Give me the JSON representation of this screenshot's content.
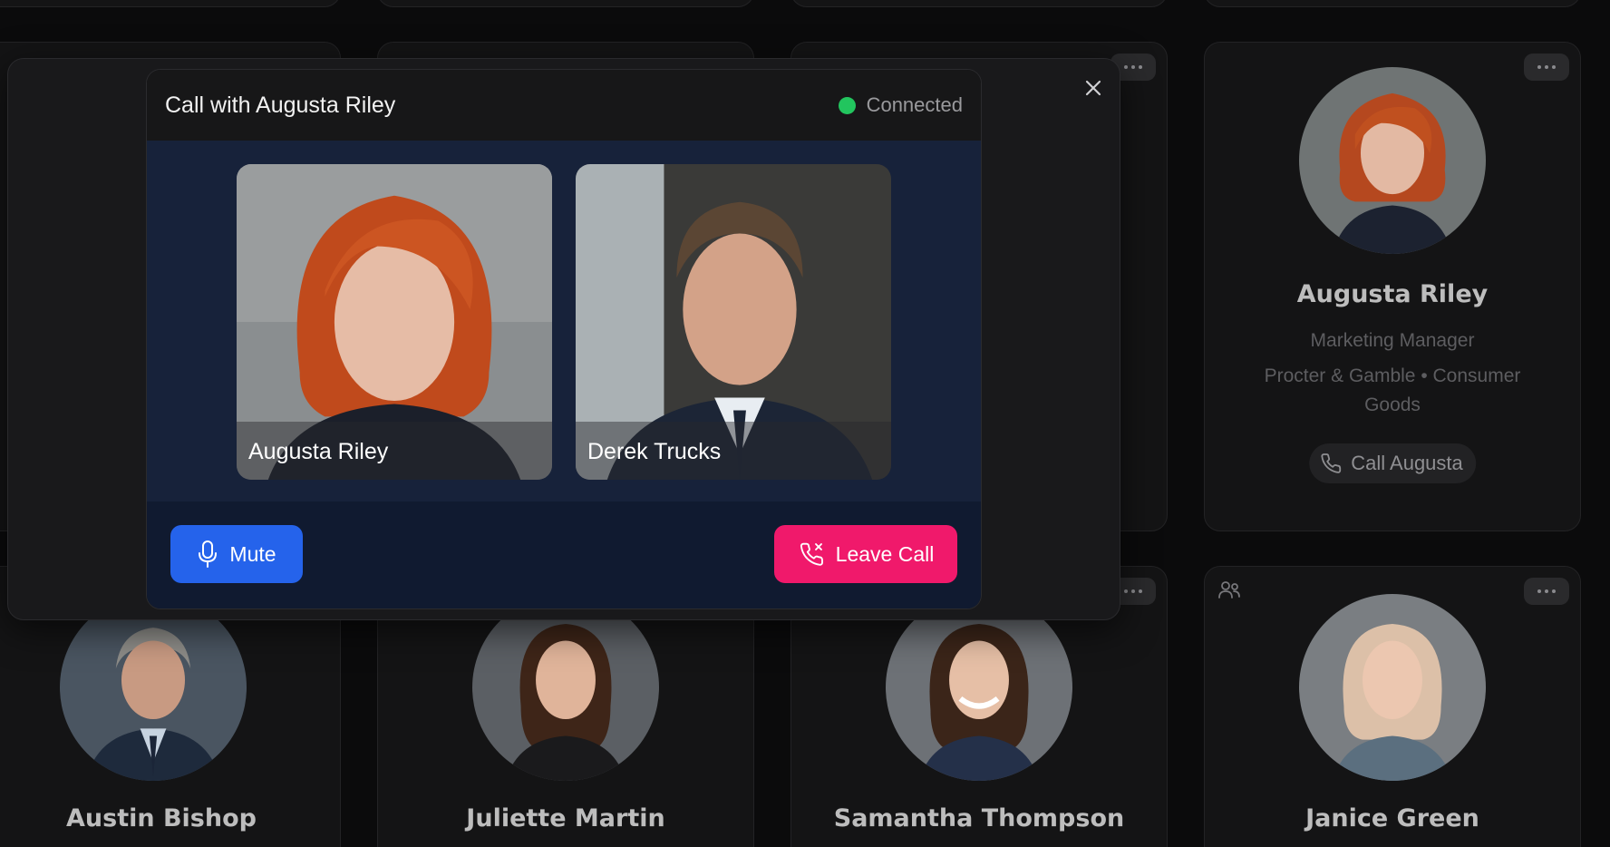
{
  "cards": [
    {
      "name": "Augusta Riley",
      "title": "Marketing Manager",
      "company": "Procter & Gamble • Consumer Goods",
      "call_label": "Call Augusta"
    },
    {
      "name": "Austin Bishop"
    },
    {
      "name": "Juliette Martin"
    },
    {
      "name": "Samantha Thompson"
    },
    {
      "name": "Janice Green"
    }
  ],
  "call": {
    "title": "Call with Augusta Riley",
    "status": "Connected",
    "participants": [
      {
        "name": "Augusta Riley"
      },
      {
        "name": "Derek Trucks"
      }
    ],
    "mute_label": "Mute",
    "leave_label": "Leave Call"
  },
  "colors": {
    "accent": "#2563eb",
    "danger": "#f0196b",
    "status_ok": "#22c55e"
  }
}
